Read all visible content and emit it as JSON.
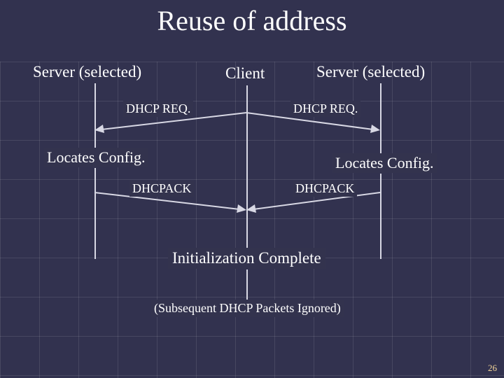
{
  "title": "Reuse of address",
  "lanes": {
    "left": "Server (selected)",
    "center": "Client",
    "right": "Server (selected)"
  },
  "messages": {
    "req_left": "DHCP REQ.",
    "req_right": "DHCP REQ.",
    "ack_left": "DHCPACK",
    "ack_right": "DHCPACK"
  },
  "states": {
    "locates_left": "Locates Config.",
    "locates_right": "Locates Config."
  },
  "init_complete": "Initialization Complete",
  "subsequent": "(Subsequent DHCP Packets Ignored)",
  "page_number": "26"
}
